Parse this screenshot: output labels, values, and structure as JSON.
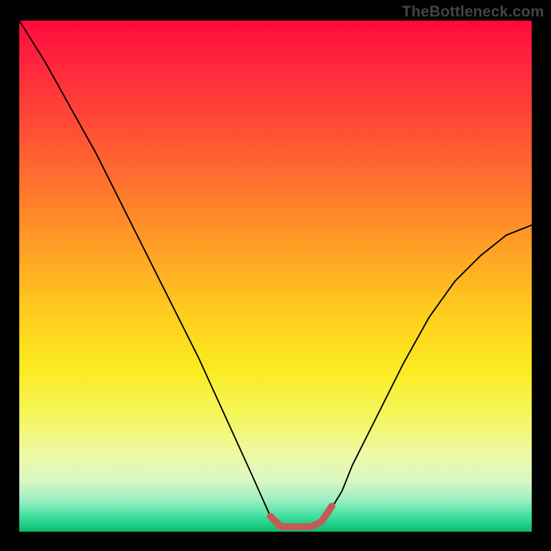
{
  "watermark": "TheBottleneck.com",
  "chart_data": {
    "type": "line",
    "title": "",
    "xlabel": "",
    "ylabel": "",
    "xlim": [
      0,
      100
    ],
    "ylim": [
      0,
      100
    ],
    "grid": false,
    "legend": false,
    "annotations": [],
    "series": [
      {
        "name": "bottleneck-curve",
        "color": "#000000",
        "x": [
          0,
          5,
          10,
          15,
          20,
          25,
          30,
          35,
          40,
          45,
          49,
          51,
          55,
          58,
          60,
          63,
          65,
          70,
          75,
          80,
          85,
          90,
          95,
          100
        ],
        "y": [
          100,
          92,
          83,
          74,
          64,
          54,
          44,
          34,
          23,
          12,
          3,
          1,
          1,
          1,
          3,
          8,
          13,
          23,
          33,
          42,
          49,
          54,
          58,
          60
        ]
      },
      {
        "name": "optimal-range-marker",
        "color": "#c65a56",
        "x": [
          49,
          51,
          54,
          57,
          59,
          61
        ],
        "y": [
          3,
          1,
          1,
          1,
          2,
          5
        ]
      }
    ],
    "gradient_stops": [
      {
        "pos": 0.0,
        "color": "#ff0a3c"
      },
      {
        "pos": 0.2,
        "color": "#ff4a36"
      },
      {
        "pos": 0.46,
        "color": "#ffa524"
      },
      {
        "pos": 0.68,
        "color": "#fbea1f"
      },
      {
        "pos": 0.85,
        "color": "#eef9a6"
      },
      {
        "pos": 0.97,
        "color": "#3fdfa0"
      },
      {
        "pos": 1.0,
        "color": "#0db96a"
      }
    ]
  }
}
